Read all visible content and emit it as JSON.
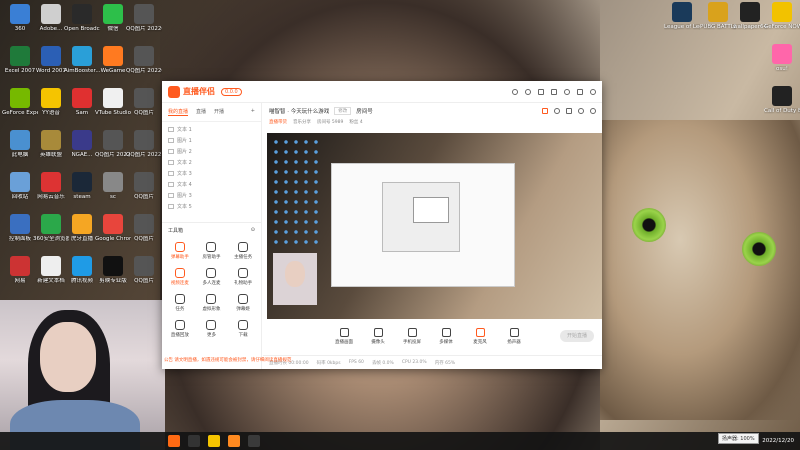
{
  "desktop_left": [
    {
      "label": "360",
      "color": "#3a7fd5"
    },
    {
      "label": "Adobe...",
      "color": "#cfcfcf"
    },
    {
      "label": "Open Broadcast...",
      "color": "#2a2a2a"
    },
    {
      "label": "微信",
      "color": "#2dbf4a"
    },
    {
      "label": "QQ图片 20220821...",
      "color": "#555"
    },
    {
      "label": "Excel 2007",
      "color": "#1f7a3a"
    },
    {
      "label": "Word 2007",
      "color": "#2b5fb5"
    },
    {
      "label": "AimBooster...",
      "color": "#2a9fd8"
    },
    {
      "label": "WeGame",
      "color": "#ff7a20"
    },
    {
      "label": "QQ图片 20220821...",
      "color": "#555"
    },
    {
      "label": "GeForce Experience",
      "color": "#76b900"
    },
    {
      "label": "YY语音",
      "color": "#f5c400"
    },
    {
      "label": "Sam",
      "color": "#e03030"
    },
    {
      "label": "VTube Studio",
      "color": "#f0f0f0"
    },
    {
      "label": "QQ图片",
      "color": "#555"
    },
    {
      "label": "此电脑",
      "color": "#4a90d0"
    },
    {
      "label": "英雄联盟",
      "color": "#a88a3a"
    },
    {
      "label": "NGAE...",
      "color": "#3a3a8a"
    },
    {
      "label": "QQ图片 2022...",
      "color": "#555"
    },
    {
      "label": "QQ图片 2022...",
      "color": "#555"
    },
    {
      "label": "回收站",
      "color": "#6aa0d8"
    },
    {
      "label": "网易云音乐",
      "color": "#d33"
    },
    {
      "label": "steam",
      "color": "#1b2838"
    },
    {
      "label": "sc",
      "color": "#888"
    },
    {
      "label": "QQ图片",
      "color": "#555"
    },
    {
      "label": "控制面板",
      "color": "#3a6fc0"
    },
    {
      "label": "360安全浏览器",
      "color": "#2ba84a"
    },
    {
      "label": "虎牙直播",
      "color": "#f5a623"
    },
    {
      "label": "Google Chrome",
      "color": "#e8453c"
    },
    {
      "label": "QQ图片",
      "color": "#555"
    },
    {
      "label": "网易",
      "color": "#c33"
    },
    {
      "label": "新建文本档",
      "color": "#eee"
    },
    {
      "label": "腾讯视频",
      "color": "#1f9be6"
    },
    {
      "label": "剪映专业版",
      "color": "#111"
    },
    {
      "label": "QQ图片",
      "color": "#555"
    }
  ],
  "desktop_right": [
    {
      "label": "League of Legends",
      "color": "#1a3a5a"
    },
    {
      "label": "PUBG BATTLEGR...",
      "color": "#d9a21c"
    },
    {
      "label": "wallpaper64",
      "color": "#222"
    },
    {
      "label": "GeForce NOW",
      "color": "#f2c200"
    },
    {
      "label": "osu!",
      "color": "#ff66aa"
    },
    {
      "label": "Call of Duty Black Ops 4",
      "color": "#222"
    }
  ],
  "window": {
    "app_name": "直播伴侣",
    "badge": "0.0.0",
    "tabs": [
      "我的直播",
      "直播",
      "开播"
    ],
    "scenes": [
      "文本 1",
      "图片 1",
      "图片 2",
      "文本 2",
      "文本 3",
      "文本 4",
      "图片 3",
      "文本 5"
    ],
    "toolbox_label": "工具箱",
    "tools": [
      {
        "label": "弹幕助手",
        "hot": true
      },
      {
        "label": "房管助手",
        "hot": false
      },
      {
        "label": "主播任务",
        "hot": false
      },
      {
        "label": "视频连麦",
        "hot": true
      },
      {
        "label": "多人连麦",
        "hot": false
      },
      {
        "label": "礼物助手",
        "hot": false
      },
      {
        "label": "任务",
        "hot": false
      },
      {
        "label": "虚拟形象",
        "hot": false
      },
      {
        "label": "弹幕姬",
        "hot": false
      },
      {
        "label": "直播回放",
        "hot": false
      },
      {
        "label": "更多",
        "hot": false
      },
      {
        "label": "下载",
        "hot": false
      }
    ],
    "room_name": "喵智智 · 今天玩什么游戏",
    "room_edit": "修改",
    "room_id": "房间号",
    "room_sub": [
      "直播带货",
      "音乐分享",
      "房间号 5989",
      "粉丝 4"
    ],
    "controls": [
      {
        "label": "直播画面",
        "hot": false
      },
      {
        "label": "摄像头",
        "hot": false
      },
      {
        "label": "手机投屏",
        "hot": false
      },
      {
        "label": "多媒体",
        "hot": false
      },
      {
        "label": "麦克风",
        "hot": true
      },
      {
        "label": "扬声器",
        "hot": false
      }
    ],
    "start_label": "开始直播",
    "status": [
      "直播时长 00:00:00",
      "码率 0kbps",
      "FPS 60",
      "丢帧 0.0%",
      "CPU 23.0%",
      "内存 65%"
    ],
    "notice": "公告 请文明直播，如遇违规可能会被封禁，请仔细阅读直播规范"
  },
  "taskbar": {
    "tooltip": "扬声器: 100%",
    "time": "",
    "date": "2022/12/20",
    "apps": [
      "#ff6a13",
      "#333",
      "#f5c400",
      "#ff8a20",
      "#3a3a3a"
    ]
  }
}
